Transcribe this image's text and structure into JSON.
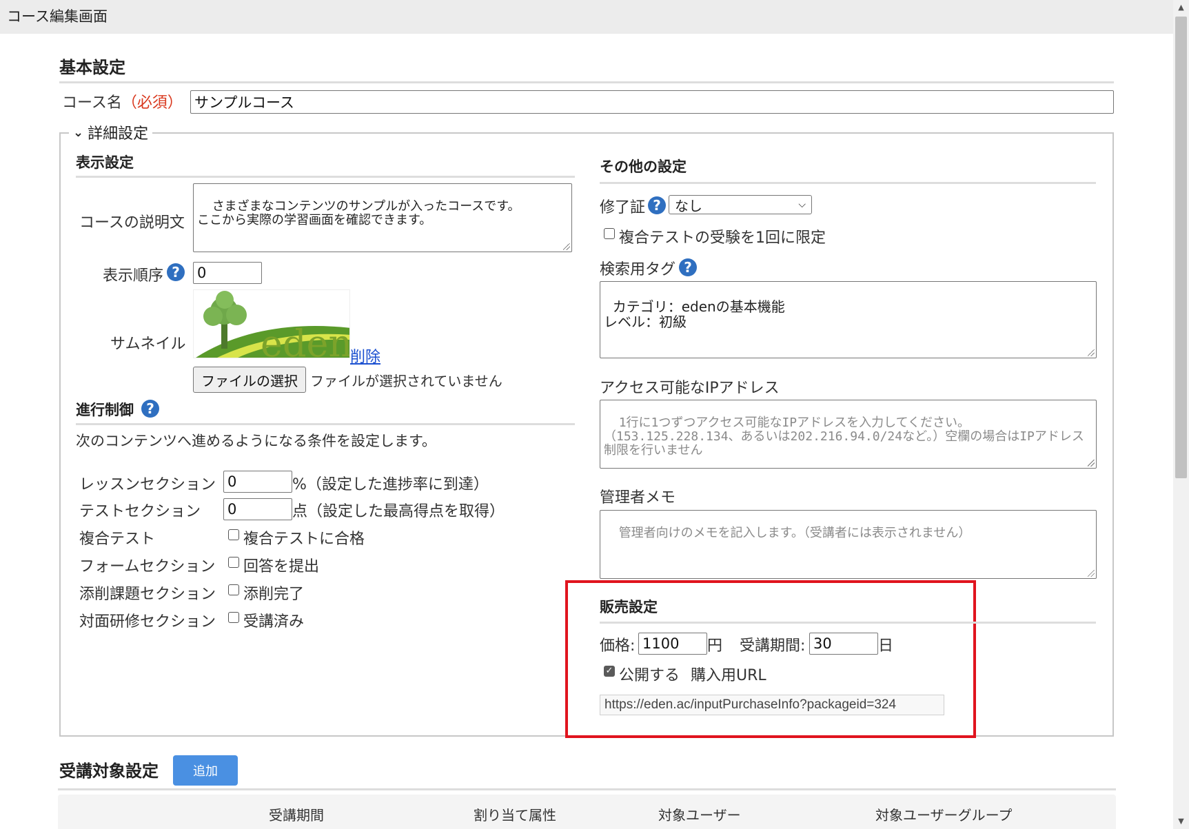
{
  "window": {
    "title": "コース編集画面"
  },
  "basic": {
    "heading": "基本設定",
    "course_name_label": "コース名",
    "required_label": "（必須）",
    "course_name_value": "サンプルコース"
  },
  "details": {
    "legend": "詳細設定",
    "display": {
      "heading": "表示設定",
      "description_label": "コースの説明文",
      "description_value": "さまざまなコンテンツのサンプルが入ったコースです。\nここから実際の学習画面を確認できます。",
      "order_label": "表示順序",
      "order_value": "0",
      "thumbnail_label": "サムネイル",
      "thumbnail_logo_text": "eden",
      "delete_link": "削除",
      "file_button": "ファイルの選択",
      "file_status": "ファイルが選択されていません"
    },
    "progress": {
      "heading": "進行制御",
      "description": "次のコンテンツへ進めるようになる条件を設定します。",
      "rows": [
        {
          "label": "レッスンセクション",
          "value": "0",
          "suffix": "%（設定した進捗率に到達）"
        },
        {
          "label": "テストセクション",
          "value": "0",
          "suffix": "点（設定した最高得点を取得）"
        }
      ],
      "checks": [
        {
          "label": "複合テスト",
          "check_label": "複合テストに合格",
          "checked": false
        },
        {
          "label": "フォームセクション",
          "check_label": "回答を提出",
          "checked": false
        },
        {
          "label": "添削課題セクション",
          "check_label": "添削完了",
          "checked": false
        },
        {
          "label": "対面研修セクション",
          "check_label": "受講済み",
          "checked": false
        }
      ]
    },
    "other": {
      "heading": "その他の設定",
      "certificate_label": "修了証",
      "certificate_value": "なし",
      "limit_test_label": "複合テストの受験を1回に限定",
      "limit_test_checked": false,
      "tags_label": "検索用タグ",
      "tags_value": "カテゴリ：edenの基本機能\nレベル：初級",
      "ip_label": "アクセス可能なIPアドレス",
      "ip_placeholder": "1行に1つずつアクセス可能なIPアドレスを入力してください。\n（153.125.228.134、あるいは202.216.94.0/24など。）空欄の場合はIPアドレス制限を行いません",
      "memo_label": "管理者メモ",
      "memo_placeholder": "管理者向けのメモを記入します。（受講者には表示されません）"
    },
    "sales": {
      "heading": "販売設定",
      "price_label": "価格:",
      "price_value": "1100",
      "price_unit": "円",
      "period_label": "受講期間:",
      "period_value": "30",
      "period_unit": "日",
      "publish_label": "公開する",
      "publish_checked": true,
      "purchase_url_label": "購入用URL",
      "purchase_url": "https://eden.ac/inputPurchaseInfo?packageid=324"
    }
  },
  "target": {
    "heading": "受講対象設定",
    "add_button": "追加",
    "columns": [
      "受講期間",
      "割り当て属性",
      "対象ユーザー",
      "対象ユーザーグループ"
    ]
  },
  "colors": {
    "accent_blue": "#4a90e2",
    "highlight_red": "#e0141e",
    "help_blue": "#2f6fc0"
  }
}
